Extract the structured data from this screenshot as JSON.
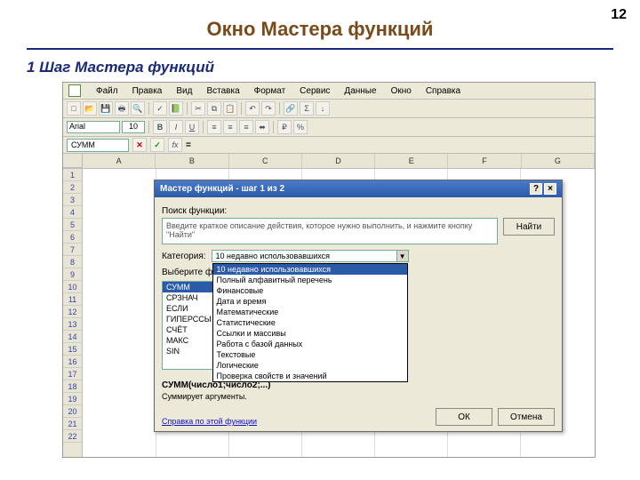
{
  "page_number": "12",
  "title": "Окно Мастера функций",
  "subtitle": "1 Шаг Мастера функций",
  "menu": [
    "Файл",
    "Правка",
    "Вид",
    "Вставка",
    "Формат",
    "Сервис",
    "Данные",
    "Окно",
    "Справка"
  ],
  "font_name": "Arial",
  "font_size": "10",
  "name_box": "СУММ",
  "formula_eq": "=",
  "cols": [
    "A",
    "B",
    "C",
    "D",
    "E",
    "F",
    "G"
  ],
  "rows": [
    "1",
    "2",
    "3",
    "4",
    "5",
    "6",
    "7",
    "8",
    "9",
    "10",
    "11",
    "12",
    "13",
    "14",
    "15",
    "16",
    "17",
    "18",
    "19",
    "20",
    "21",
    "22"
  ],
  "wizard": {
    "title": "Мастер функций - шаг 1 из 2",
    "search_label": "Поиск функции:",
    "search_placeholder": "Введите краткое описание действия, которое нужно выполнить, и нажмите кнопку \"Найти\"",
    "find_btn": "Найти",
    "category_label": "Категория:",
    "category_selected": "10 недавно использовавшихся",
    "categories": [
      "10 недавно использовавшихся",
      "Полный алфавитный перечень",
      "Финансовые",
      "Дата и время",
      "Математические",
      "Статистические",
      "Ссылки и массивы",
      "Работа с базой данных",
      "Текстовые",
      "Логические",
      "Проверка свойств и значений"
    ],
    "select_func_label": "Выберите фу",
    "functions": [
      "СУММ",
      "СРЗНАЧ",
      "ЕСЛИ",
      "ГИПЕРССЫ",
      "СЧЁТ",
      "МАКС",
      "SIN"
    ],
    "signature": "СУММ(число1;число2;...)",
    "description": "Суммирует аргументы.",
    "help_link": "Справка по этой функции",
    "ok": "ОК",
    "cancel": "Отмена"
  }
}
